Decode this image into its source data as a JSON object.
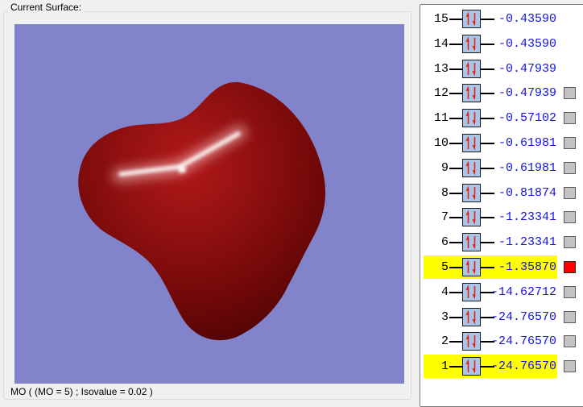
{
  "surface_panel": {
    "title": "Current Surface:",
    "status": "MO ( (MO = 5) ; Isovalue = 0.02 )",
    "viewport_bg": "#8183cb",
    "surface_base_color": "#8e0f0f",
    "surface_highlight_color": "#ffffff"
  },
  "mo_list": {
    "value_color": "#1414e6",
    "number_color": "#000000",
    "highlight_color": "#ffff00",
    "spin_box_fill": "#aac6e6",
    "arrow_color": "#e42222",
    "checkbox_gray": "#c3c3c3",
    "checkbox_red": "#ff0000",
    "rows": [
      {
        "index": "15",
        "energy": "-0.43590",
        "highlighted": false,
        "checkbox": null
      },
      {
        "index": "14",
        "energy": "-0.43590",
        "highlighted": false,
        "checkbox": null
      },
      {
        "index": "13",
        "energy": "-0.47939",
        "highlighted": false,
        "checkbox": null
      },
      {
        "index": "12",
        "energy": "-0.47939",
        "highlighted": false,
        "checkbox": "gray"
      },
      {
        "index": "11",
        "energy": "-0.57102",
        "highlighted": false,
        "checkbox": "gray"
      },
      {
        "index": "10",
        "energy": "-0.61981",
        "highlighted": false,
        "checkbox": "gray"
      },
      {
        "index": "9",
        "energy": "-0.61981",
        "highlighted": false,
        "checkbox": "gray"
      },
      {
        "index": "8",
        "energy": "-0.81874",
        "highlighted": false,
        "checkbox": "gray"
      },
      {
        "index": "7",
        "energy": "-1.23341",
        "highlighted": false,
        "checkbox": "gray"
      },
      {
        "index": "6",
        "energy": "-1.23341",
        "highlighted": false,
        "checkbox": "gray"
      },
      {
        "index": "5",
        "energy": "-1.35870",
        "highlighted": true,
        "checkbox": "red"
      },
      {
        "index": "4",
        "energy": "-14.62712",
        "highlighted": false,
        "checkbox": "gray"
      },
      {
        "index": "3",
        "energy": "-24.76570",
        "highlighted": false,
        "checkbox": "gray"
      },
      {
        "index": "2",
        "energy": "-24.76570",
        "highlighted": false,
        "checkbox": "gray"
      },
      {
        "index": "1",
        "energy": "-24.76570",
        "highlighted": true,
        "checkbox": "gray"
      }
    ]
  }
}
